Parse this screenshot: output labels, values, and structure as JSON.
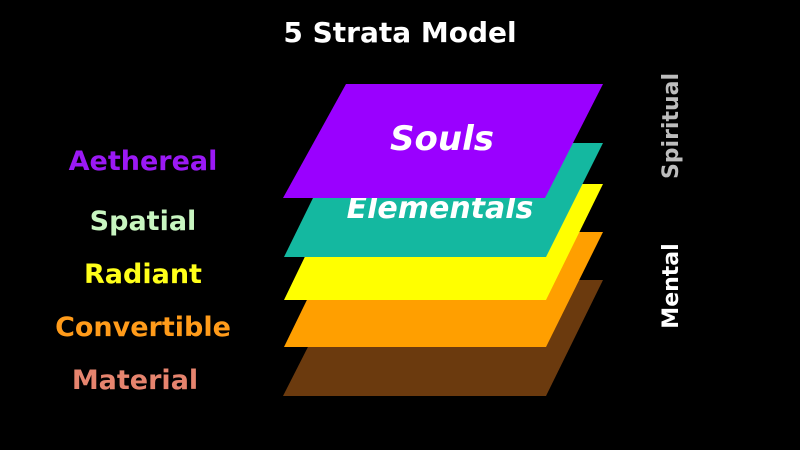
{
  "title": "5 Strata Model",
  "strata": [
    {
      "label": "Aethereal",
      "color": "#9b19f5"
    },
    {
      "label": "Spatial",
      "color": "#c8f5c0"
    },
    {
      "label": "Radiant",
      "color": "#ffff1a"
    },
    {
      "label": "Convertible",
      "color": "#ff9b1a"
    },
    {
      "label": "Material",
      "color": "#e6846e"
    }
  ],
  "layers": [
    {
      "name": "",
      "color": "#6b3a0e"
    },
    {
      "name": "",
      "color": "#ff9f00"
    },
    {
      "name": "",
      "color": "#ffff00"
    },
    {
      "name": "Elementals",
      "color": "#14b8a0"
    },
    {
      "name": "Souls",
      "color": "#9a00ff"
    }
  ],
  "side_labels": {
    "upper": {
      "text": "Spiritual",
      "color": "#bdbdbd"
    },
    "lower": {
      "text": "Mental",
      "color": "#ffffff"
    }
  }
}
